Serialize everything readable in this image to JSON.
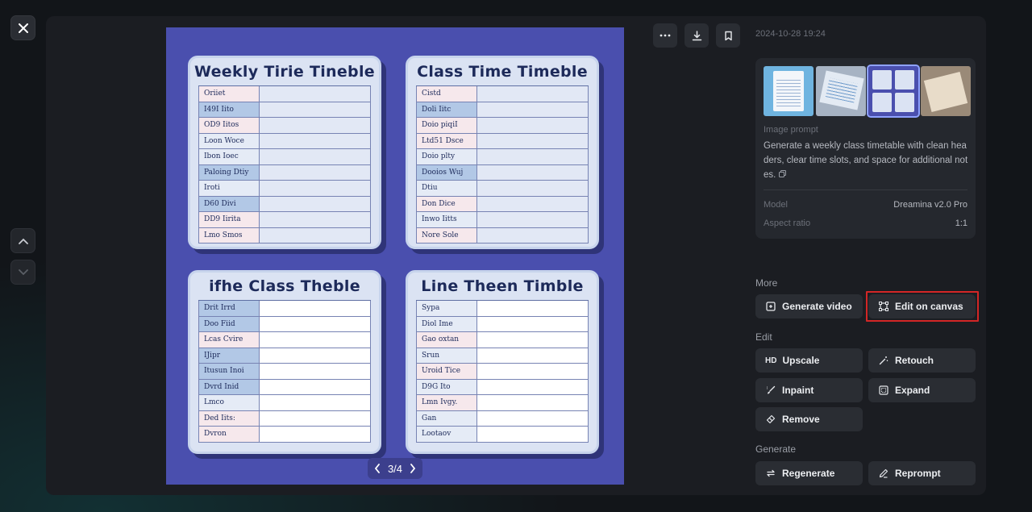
{
  "viewer": {
    "close_label": "×",
    "pager": {
      "text": "3/4"
    }
  },
  "timetables": [
    {
      "title": "Weekly Tirie Tineble",
      "style": "pale",
      "rows": [
        {
          "label": "Oriiet",
          "tone": "pink"
        },
        {
          "label": "I49I Iito",
          "tone": "blue"
        },
        {
          "label": "OD9 Iitos",
          "tone": "pink"
        },
        {
          "label": "Loon Woce",
          "tone": "pale"
        },
        {
          "label": "Ibon Ioec",
          "tone": "pale"
        },
        {
          "label": "Paloing Dtiy",
          "tone": "blue"
        },
        {
          "label": "Iroti",
          "tone": "pale"
        },
        {
          "label": "D60 Divi",
          "tone": "blue"
        },
        {
          "label": "DD9 Iirita",
          "tone": "pink"
        },
        {
          "label": "Lmo Smos",
          "tone": "pink"
        }
      ]
    },
    {
      "title": "Class   Time Timeble",
      "style": "pale",
      "rows": [
        {
          "label": "Cistd",
          "tone": "pink"
        },
        {
          "label": "Doli Iitc",
          "tone": "blue"
        },
        {
          "label": "Doio piqiI",
          "tone": "pink"
        },
        {
          "label": "Ltd51 Dsce",
          "tone": "pink"
        },
        {
          "label": "Doio plty",
          "tone": "pale"
        },
        {
          "label": "Dooios Wuj",
          "tone": "blue"
        },
        {
          "label": "Dtiu",
          "tone": "pale"
        },
        {
          "label": "Don Dice",
          "tone": "pink"
        },
        {
          "label": "Inwo Iitts",
          "tone": "pale"
        },
        {
          "label": "Nore Sole",
          "tone": "pink"
        }
      ]
    },
    {
      "title": "ifhe    Class Theble",
      "style": "light",
      "rows": [
        {
          "label": "Drit Irrd",
          "tone": "blue"
        },
        {
          "label": "Doo Fiid",
          "tone": "blue"
        },
        {
          "label": "Lcas Cvire",
          "tone": "pink"
        },
        {
          "label": "   IJipr",
          "tone": "blue"
        },
        {
          "label": "Itusun Inoi",
          "tone": "blue"
        },
        {
          "label": "Dvrd Inid",
          "tone": "blue"
        },
        {
          "label": "Lmco",
          "tone": "pale"
        },
        {
          "label": "Ded Iits:",
          "tone": "pink"
        },
        {
          "label": "Dvron",
          "tone": "pink"
        }
      ]
    },
    {
      "title": "Line    Theen Timble",
      "style": "light",
      "rows": [
        {
          "label": "Sypa",
          "tone": "pale"
        },
        {
          "label": "Diol Ime",
          "tone": "pale"
        },
        {
          "label": "Gao oxtan",
          "tone": "pink"
        },
        {
          "label": "Srun",
          "tone": "pale"
        },
        {
          "label": "Uroid Tice",
          "tone": "pink"
        },
        {
          "label": "D9G Ito",
          "tone": "pale"
        },
        {
          "label": "Lmn Ivgy.",
          "tone": "pink"
        },
        {
          "label": "Gan",
          "tone": "pale"
        },
        {
          "label": "Lootaov",
          "tone": "pale"
        }
      ]
    }
  ],
  "side": {
    "timestamp": "2024-10-28 19:24",
    "prompt_label": "Image prompt",
    "prompt_text": "Generate a weekly class timetable with clean headers, clear time slots, and space for additional notes.",
    "model_key": "Model",
    "model_value": "Dreamina v2.0 Pro",
    "aspect_key": "Aspect ratio",
    "aspect_value": "1:1",
    "more_label": "More",
    "edit_label": "Edit",
    "generate_label": "Generate",
    "buttons": {
      "generate_video": "Generate video",
      "edit_on_canvas": "Edit on canvas",
      "upscale": "Upscale",
      "upscale_icon_text": "HD",
      "retouch": "Retouch",
      "inpaint": "Inpaint",
      "expand": "Expand",
      "remove": "Remove",
      "regenerate": "Regenerate",
      "reprompt": "Reprompt"
    }
  },
  "colors": {
    "canvas_bg": "#4a4fae",
    "highlight": "#d32626",
    "panel_bg": "#1b1d22"
  }
}
